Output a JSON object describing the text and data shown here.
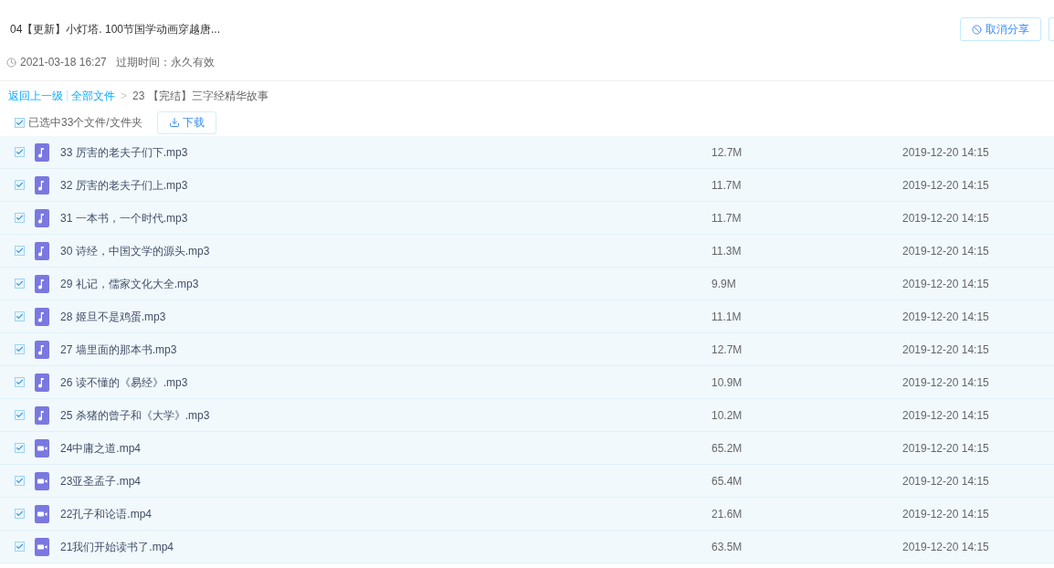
{
  "share": {
    "title": "04【更新】小灯塔. 100节国学动画穿越唐...",
    "cancel_button": "取消分享",
    "date": "2021-03-18 16:27",
    "expiry": "过期时间：永久有效"
  },
  "breadcrumb": {
    "back": "返回上一级",
    "root": "全部文件",
    "separator": ">",
    "current": "23 【完结】三字经精华故事"
  },
  "selection": {
    "checked": true,
    "label": "已选中33个文件/文件夹",
    "download_button": "下载"
  },
  "files": [
    {
      "name": "33 厉害的老夫子们下.mp3",
      "kind": "audio",
      "size": "12.7M",
      "date": "2019-12-20 14:15",
      "checked": true
    },
    {
      "name": "32 厉害的老夫子们上.mp3",
      "kind": "audio",
      "size": "11.7M",
      "date": "2019-12-20 14:15",
      "checked": true
    },
    {
      "name": "31 一本书，一个时代.mp3",
      "kind": "audio",
      "size": "11.7M",
      "date": "2019-12-20 14:15",
      "checked": true
    },
    {
      "name": "30 诗经，中国文学的源头.mp3",
      "kind": "audio",
      "size": "11.3M",
      "date": "2019-12-20 14:15",
      "checked": true
    },
    {
      "name": "29 礼记，儒家文化大全.mp3",
      "kind": "audio",
      "size": "9.9M",
      "date": "2019-12-20 14:15",
      "checked": true
    },
    {
      "name": "28 姬旦不是鸡蛋.mp3",
      "kind": "audio",
      "size": "11.1M",
      "date": "2019-12-20 14:15",
      "checked": true
    },
    {
      "name": "27 墙里面的那本书.mp3",
      "kind": "audio",
      "size": "12.7M",
      "date": "2019-12-20 14:15",
      "checked": true
    },
    {
      "name": "26 读不懂的《易经》.mp3",
      "kind": "audio",
      "size": "10.9M",
      "date": "2019-12-20 14:15",
      "checked": true
    },
    {
      "name": "25 杀猪的曾子和《大学》.mp3",
      "kind": "audio",
      "size": "10.2M",
      "date": "2019-12-20 14:15",
      "checked": true
    },
    {
      "name": "24中庸之道.mp4",
      "kind": "video",
      "size": "65.2M",
      "date": "2019-12-20 14:15",
      "checked": true
    },
    {
      "name": "23亚圣孟子.mp4",
      "kind": "video",
      "size": "65.4M",
      "date": "2019-12-20 14:15",
      "checked": true
    },
    {
      "name": "22孔子和论语.mp4",
      "kind": "video",
      "size": "21.6M",
      "date": "2019-12-20 14:15",
      "checked": true
    },
    {
      "name": "21我们开始读书了.mp4",
      "kind": "video",
      "size": "63.5M",
      "date": "2019-12-20 14:15",
      "checked": true
    }
  ]
}
